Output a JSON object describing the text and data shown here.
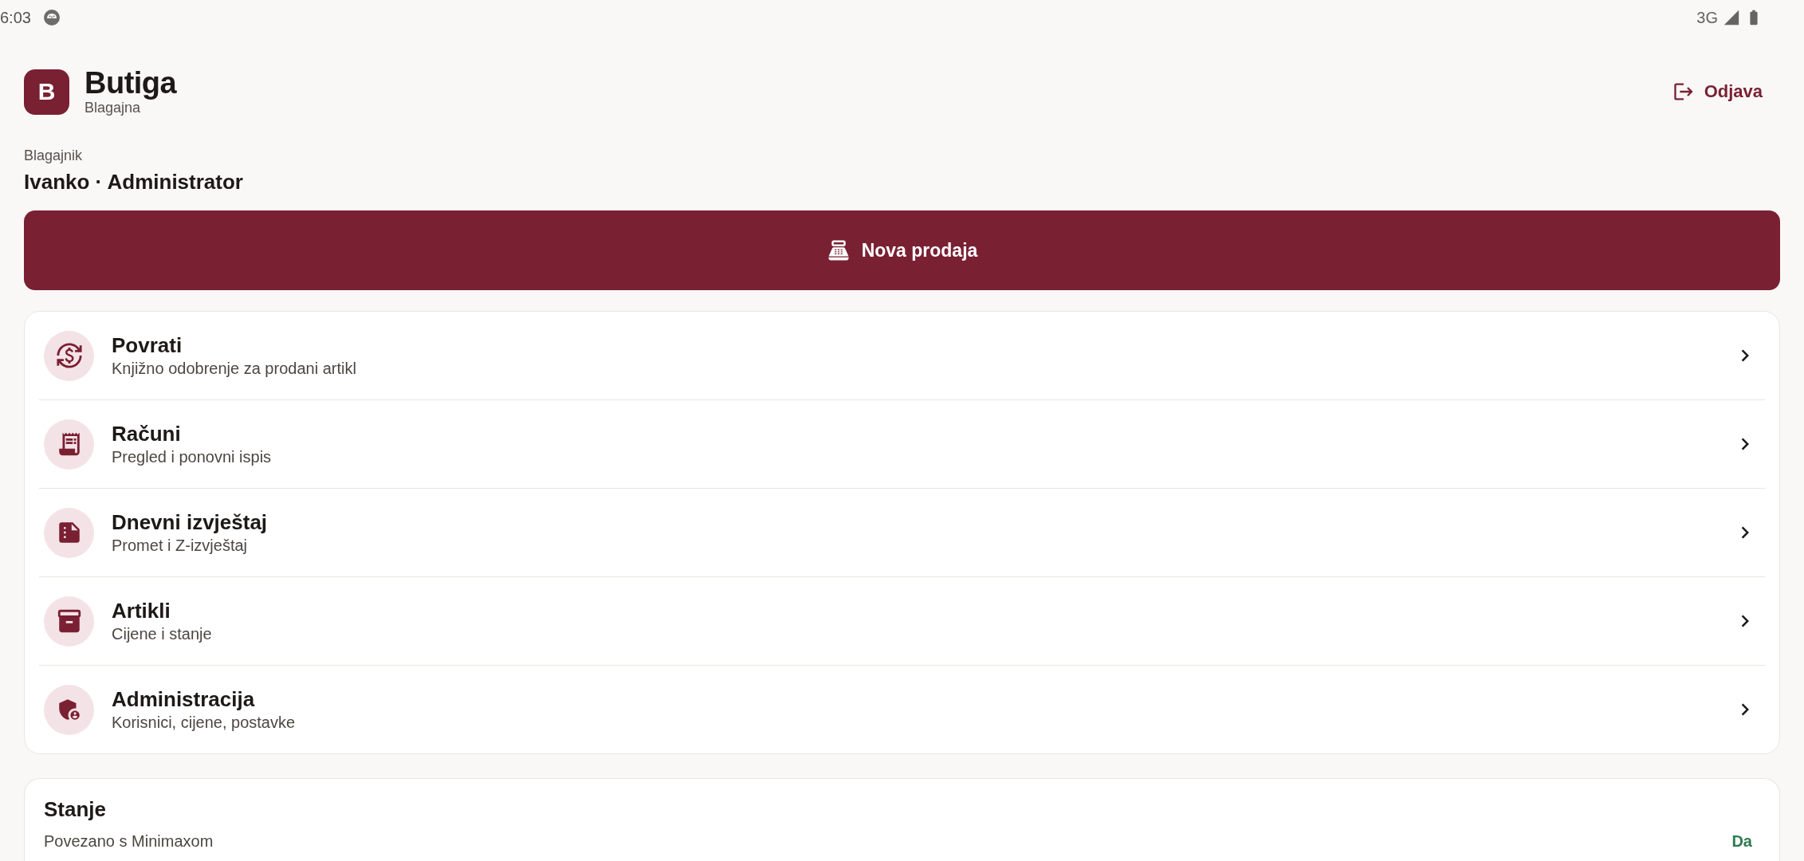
{
  "status_bar": {
    "time": "6:03",
    "network": "3G"
  },
  "header": {
    "logo_letter": "B",
    "app_name": "Butiga",
    "subtitle": "Blagajna",
    "logout": {
      "label": "Odjava"
    }
  },
  "cashier": {
    "label": "Blagajnik",
    "value": "Ivanko · Administrator"
  },
  "primary_action": {
    "label": "Nova prodaja"
  },
  "menu": [
    {
      "title": "Povrati",
      "subtitle": "Knjižno odobrenje za prodani artikl"
    },
    {
      "title": "Računi",
      "subtitle": "Pregled i ponovni ispis"
    },
    {
      "title": "Dnevni izvještaj",
      "subtitle": "Promet i Z-izvještaj"
    },
    {
      "title": "Artikli",
      "subtitle": "Cijene i stanje"
    },
    {
      "title": "Administracija",
      "subtitle": "Korisnici, cijene, postavke"
    }
  ],
  "status_card": {
    "title": "Stanje",
    "rows": [
      {
        "label": "Povezano s Minimaxom",
        "value": "Da"
      }
    ]
  }
}
